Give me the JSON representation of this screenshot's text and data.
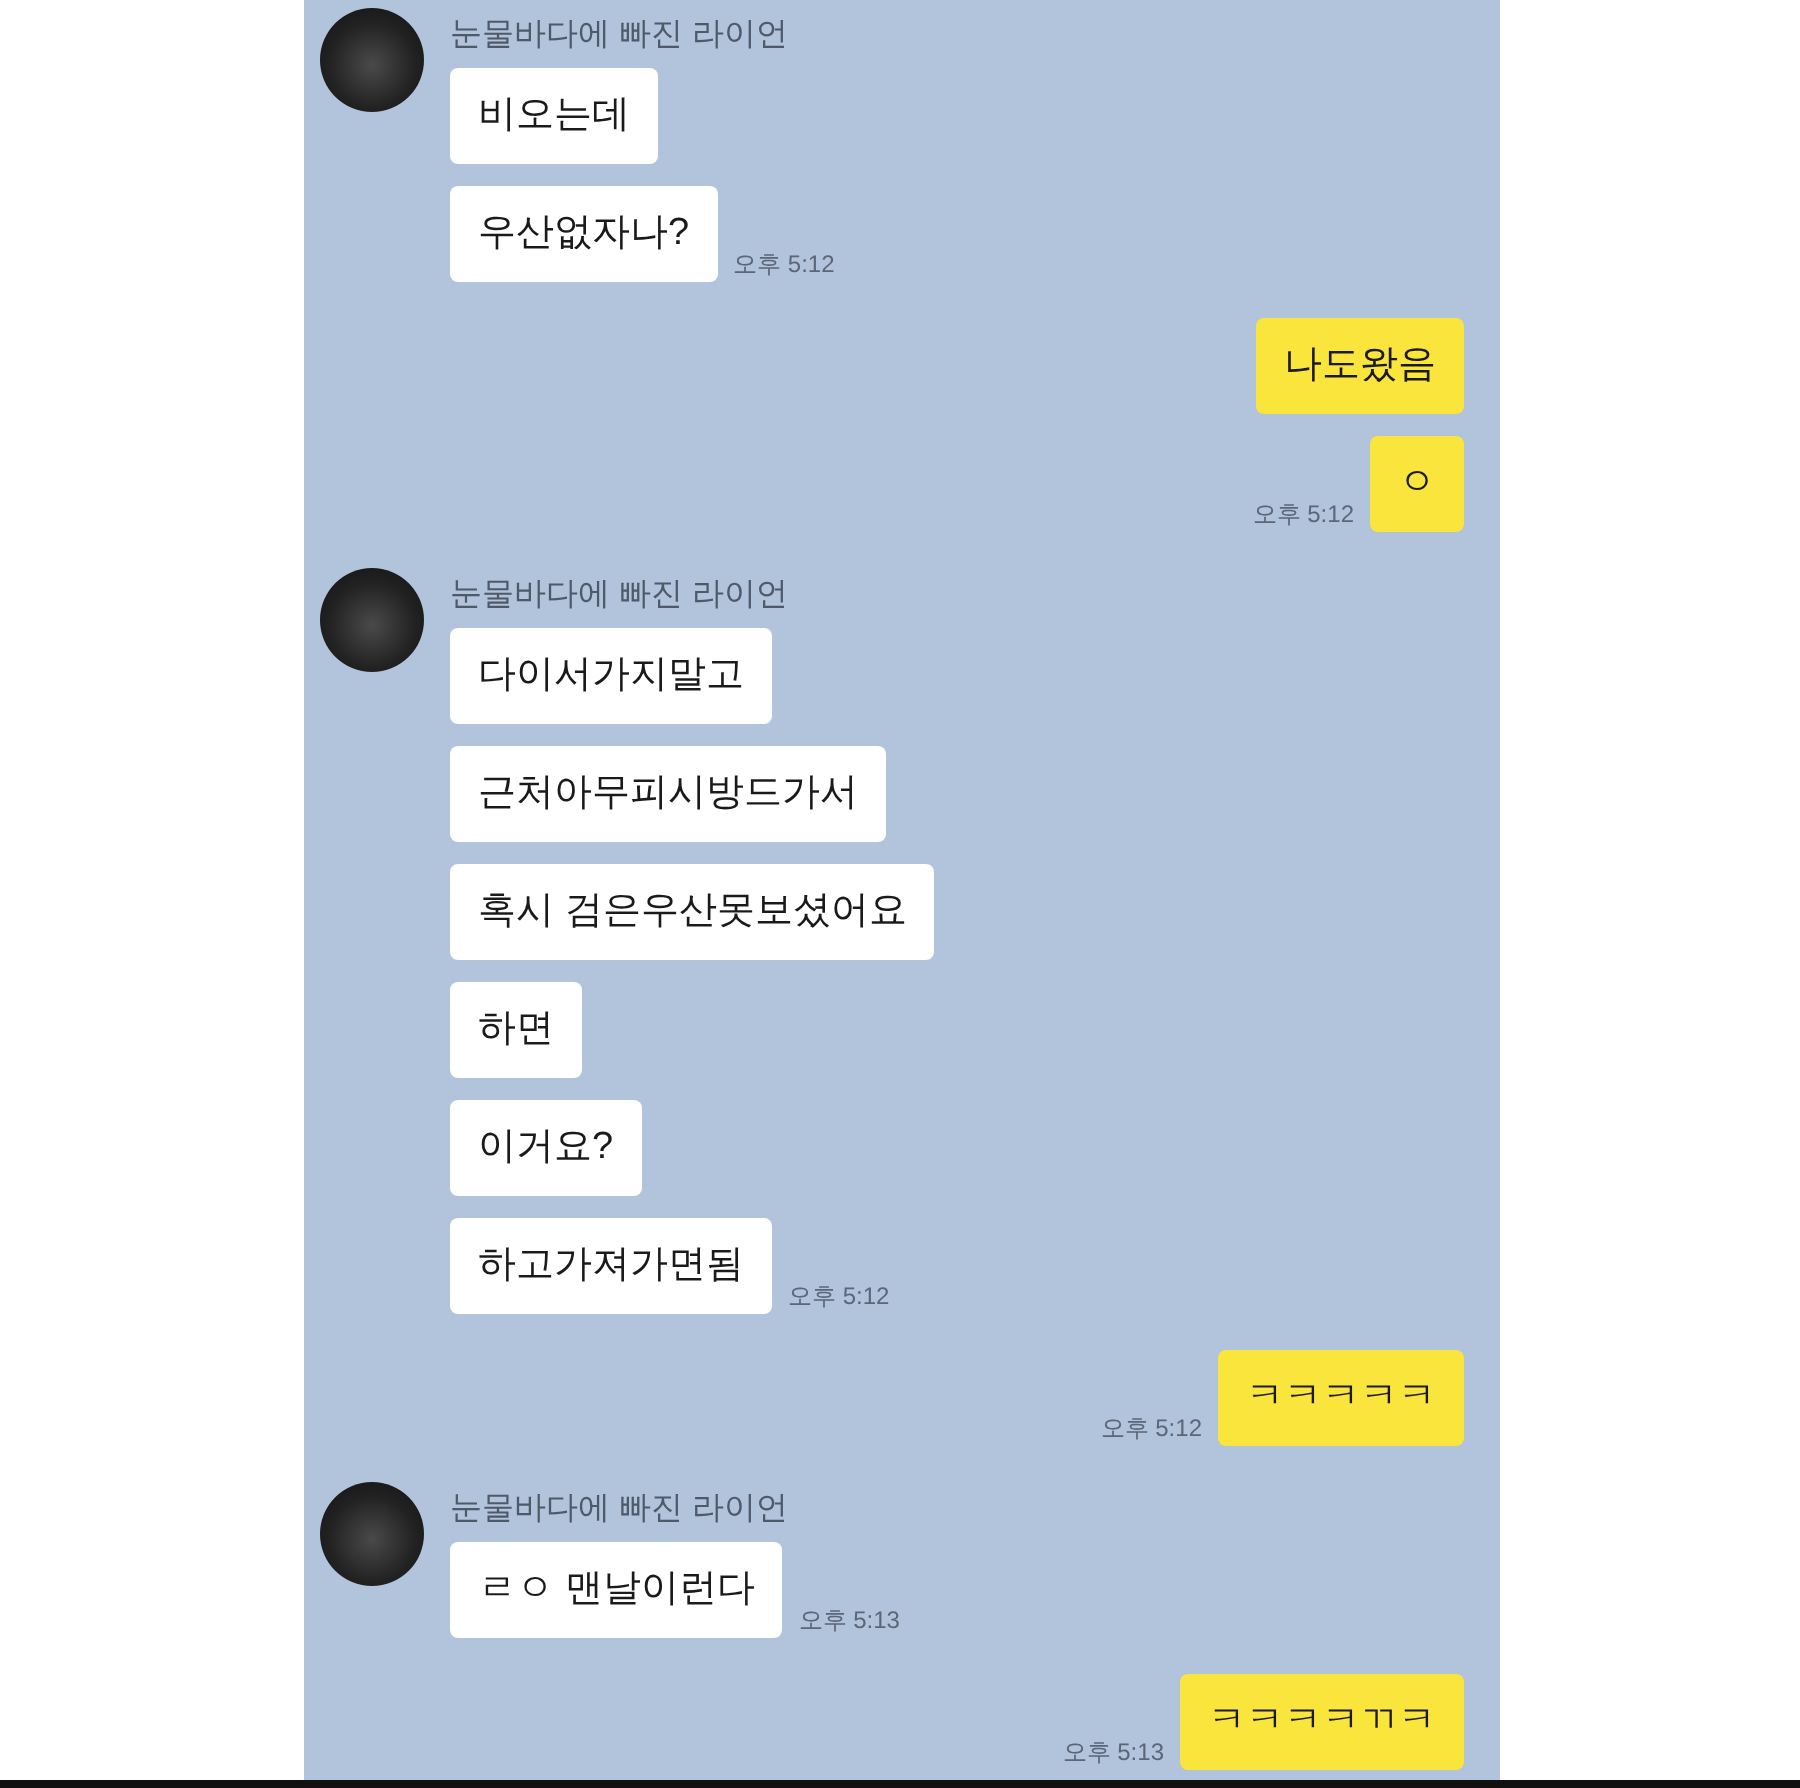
{
  "groups": [
    {
      "kind": "received",
      "sender": "눈물바다에 빠진 라이언",
      "messages": [
        "비오는데",
        "우산없자나?"
      ],
      "time": "오후 5:12"
    },
    {
      "kind": "sent",
      "messages": [
        "나도왔음",
        "ㅇ"
      ],
      "time": "오후 5:12"
    },
    {
      "kind": "received",
      "sender": "눈물바다에 빠진 라이언",
      "messages": [
        "다이서가지말고",
        "근처아무피시방드가서",
        "혹시 검은우산못보셨어요",
        "하면",
        "이거요?",
        "하고가져가면됨"
      ],
      "time": "오후 5:12"
    },
    {
      "kind": "sent",
      "messages": [
        "ㅋㅋㅋㅋㅋ"
      ],
      "time": "오후 5:12"
    },
    {
      "kind": "received",
      "sender": "눈물바다에 빠진 라이언",
      "messages": [
        "ㄹㅇ 맨날이런다"
      ],
      "time": "오후 5:13"
    },
    {
      "kind": "sent",
      "messages": [
        "ㅋㅋㅋㅋㄲㅋ"
      ],
      "time": "오후 5:13"
    }
  ]
}
